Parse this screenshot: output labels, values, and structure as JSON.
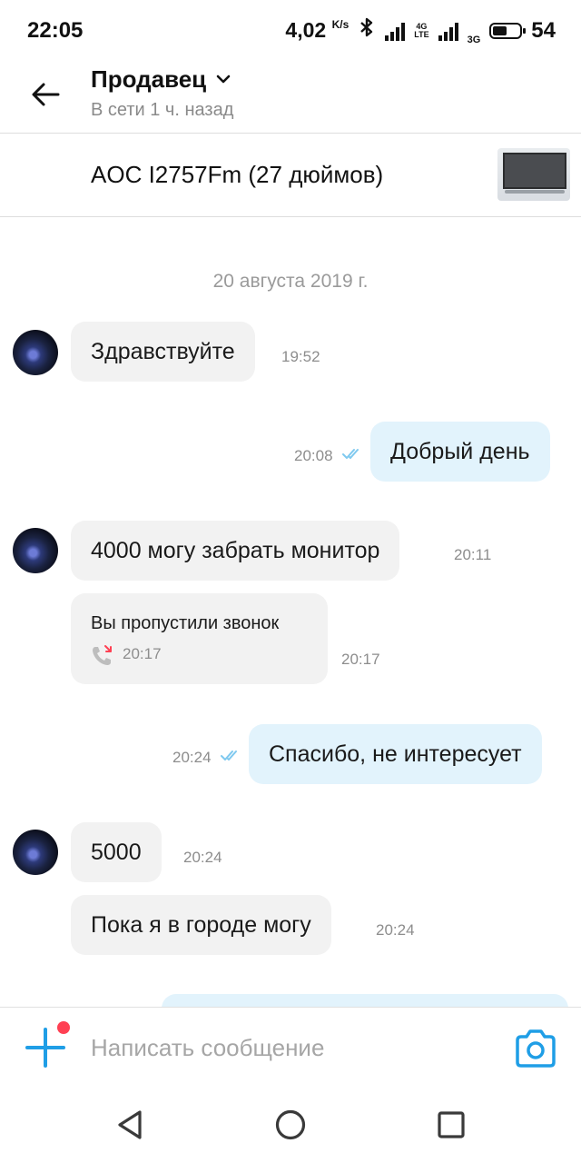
{
  "status_bar": {
    "time": "22:05",
    "net_speed_value": "4,02",
    "net_speed_unit": "K/s",
    "net_label_4g": "4G",
    "net_label_lte": "LTE",
    "net_label_3g": "3G",
    "battery": "54",
    "battery_level": 0.54
  },
  "header": {
    "seller_name": "Продавец",
    "seller_status": "В сети 1 ч. назад"
  },
  "item": {
    "title": "AOC I2757Fm (27 дюймов)"
  },
  "chat": {
    "date": "20 августа 2019 г.",
    "messages": [
      {
        "side": "incoming",
        "text": "Здравствуйте",
        "time": "19:52"
      },
      {
        "side": "outgoing",
        "text": "Добрый день",
        "time": "20:08"
      },
      {
        "side": "incoming",
        "text": "4000 могу забрать монитор",
        "time": "20:11"
      },
      {
        "side": "incoming",
        "type": "missed_call",
        "text": "Вы пропустили звонок",
        "call_time": "20:17",
        "time": "20:17"
      },
      {
        "side": "outgoing",
        "text": "Спасибо, не интересует",
        "time": "20:24"
      },
      {
        "side": "incoming",
        "text": "5000",
        "time": "20:24"
      },
      {
        "side": "incoming",
        "text": "Пока я в городе могу",
        "time": "20:24"
      }
    ]
  },
  "input": {
    "placeholder": "Написать сообщение"
  },
  "colors": {
    "accent": "#1f9ee6",
    "incoming_bubble": "#f2f2f2",
    "outgoing_bubble": "#e2f3fc",
    "badge": "#ff4053"
  },
  "icons": [
    "back-arrow-icon",
    "chevron-down-icon",
    "double-check-icon",
    "missed-call-icon",
    "plus-icon",
    "camera-icon",
    "nav-back-icon",
    "nav-home-icon",
    "nav-recents-icon"
  ]
}
